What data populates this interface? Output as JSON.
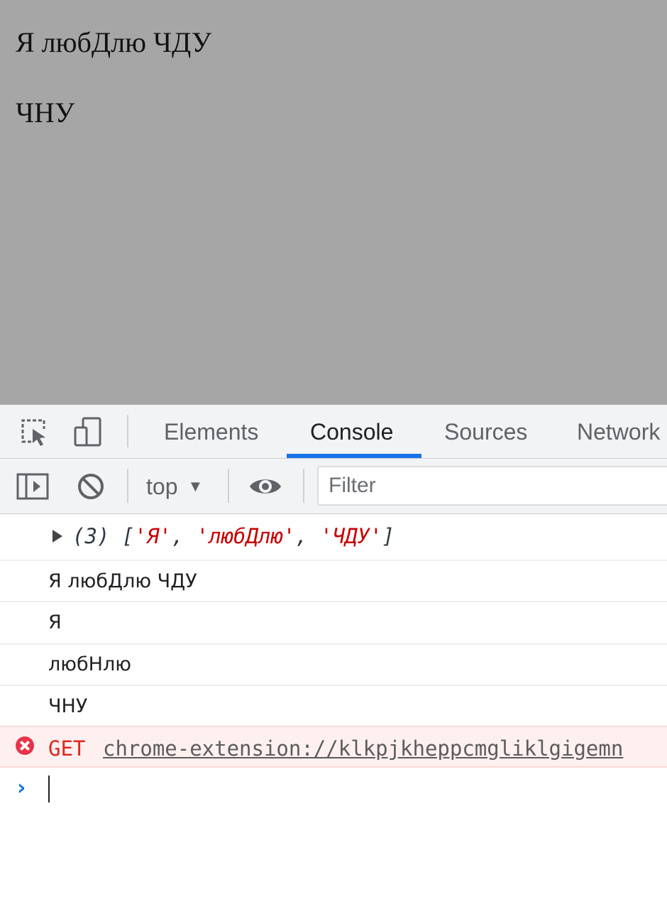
{
  "page": {
    "line1": "Я любДлю ЧДУ",
    "line2": "ЧНУ"
  },
  "devtools": {
    "tabs": [
      {
        "label": "Elements",
        "active": false
      },
      {
        "label": "Console",
        "active": true
      },
      {
        "label": "Sources",
        "active": false
      },
      {
        "label": "Network",
        "active": false
      }
    ],
    "toolbar": {
      "context": "top",
      "filter_placeholder": "Filter"
    },
    "console": {
      "array_message": {
        "count_label": "(3)",
        "items": [
          "'Я'",
          "'любДлю'",
          "'ЧДУ'"
        ]
      },
      "log_lines": [
        "Я любДлю ЧДУ",
        "Я",
        "любНлю",
        "ЧНУ"
      ],
      "error": {
        "method": "GET",
        "url": "chrome-extension://klkpjkheppcmgliklgigemn"
      }
    }
  },
  "colors": {
    "page_background": "#a6a6a6",
    "devtools_toolbar": "#f1f3f4",
    "active_tab_underline": "#1a73e8",
    "string_value": "#c80000",
    "error_text": "#e1261c",
    "error_background": "#fff0f0"
  },
  "icons": [
    "inspect-element-icon",
    "device-toggle-icon",
    "sidebar-toggle-icon",
    "clear-console-icon",
    "dropdown-caret-icon",
    "live-expression-eye-icon",
    "error-icon",
    "prompt-chevron-icon"
  ]
}
